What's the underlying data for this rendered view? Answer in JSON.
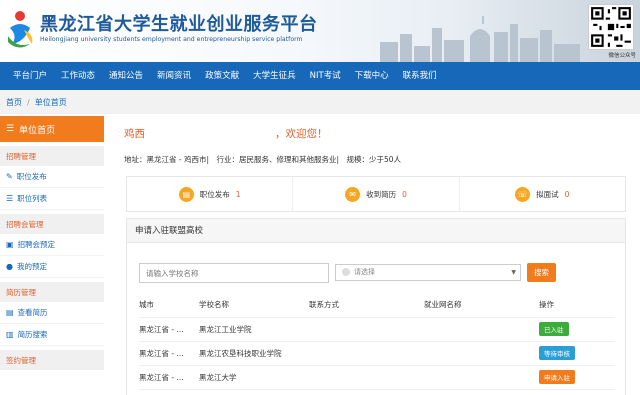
{
  "header": {
    "title": "黑龙江省大学生就业创业服务平台",
    "subtitle": "Heilongjiang university students employment and entrepreneurship service platform",
    "qr_label": "微信公众号"
  },
  "nav": {
    "items": [
      "平台门户",
      "工作动态",
      "通知公告",
      "新闻资讯",
      "政策文献",
      "大学生征兵",
      "NIT考试",
      "下载中心",
      "联系我们"
    ]
  },
  "breadcrumb": {
    "home": "首页",
    "sep": "/",
    "current": "单位首页"
  },
  "sidebar": {
    "head": "单位首页",
    "groups": [
      {
        "label": "招聘管理",
        "items": [
          "职位发布",
          "职位列表"
        ]
      },
      {
        "label": "招聘会管理",
        "items": [
          "招聘会预定",
          "我的预定"
        ]
      },
      {
        "label": "简历管理",
        "items": [
          "查看简历",
          "简历搜索"
        ]
      },
      {
        "label": "签约管理",
        "items": []
      }
    ]
  },
  "main": {
    "welcome_name": "鸡西",
    "welcome_suffix": "，欢迎您！",
    "info": {
      "address": "地址：黑龙江省 - 鸡西市",
      "industry": "行业：居民服务、修理和其他服务业",
      "scale": "规模：少于50人"
    },
    "stats": [
      {
        "label": "职位发布",
        "value": "1",
        "icon": "briefcase-icon"
      },
      {
        "label": "收到简历",
        "value": "0",
        "icon": "resume-icon"
      },
      {
        "label": "拟面试",
        "value": "0",
        "icon": "interview-icon"
      }
    ],
    "panel": {
      "title": "申请入驻联盟高校",
      "search_placeholder": "请输入学校名称",
      "select_placeholder": "请选择",
      "search_button": "搜索",
      "columns": [
        "城市",
        "学校名称",
        "联系方式",
        "就业网名称",
        "操作"
      ],
      "rows": [
        {
          "city": "黑龙江省 - ...",
          "school": "黑龙江工业学院",
          "contact": "",
          "site": "",
          "action": "已入驻",
          "action_color": "#3dab3d"
        },
        {
          "city": "黑龙江省 - ...",
          "school": "黑龙江农垦科技职业学院",
          "contact": "",
          "site": "",
          "action": "等待审核",
          "action_color": "#2a9fd6"
        },
        {
          "city": "黑龙江省 - ...",
          "school": "黑龙江大学",
          "contact": "",
          "site": "",
          "action": "申请入驻",
          "action_color": "#f07c1e"
        }
      ]
    }
  }
}
